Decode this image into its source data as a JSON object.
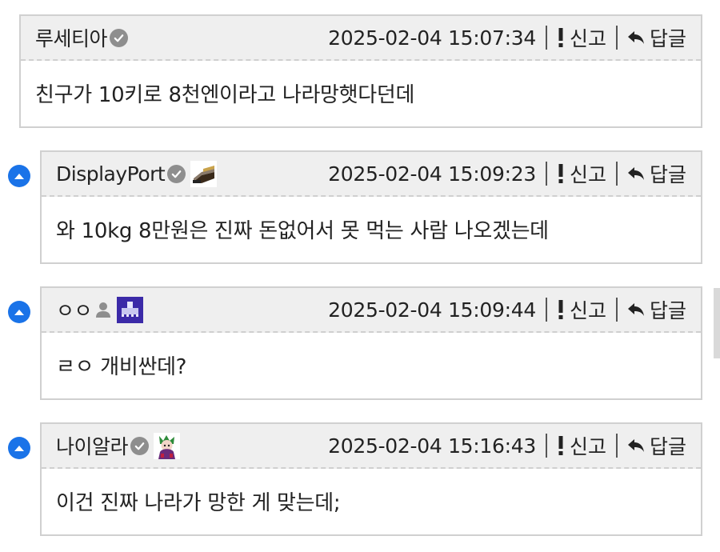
{
  "labels": {
    "report": "신고",
    "reply": "답글"
  },
  "colors": {
    "reply_dot": "#1a73e8",
    "header_bg": "#efefef",
    "border": "#d0d0d0"
  },
  "comments": [
    {
      "author": "루세티아",
      "verified": true,
      "avatar": null,
      "timestamp": "2025-02-04 15:07:34",
      "text": "친구가 10키로 8천엔이라고 나라망햇다던데",
      "is_reply": false
    },
    {
      "author": "DisplayPort",
      "verified": true,
      "avatar": "displayport-connector-icon",
      "timestamp": "2025-02-04 15:09:23",
      "text": "와 10kg 8만원은 진짜 돈없어서 못 먹는 사람 나오겠는데",
      "is_reply": true
    },
    {
      "author": "ㅇㅇ",
      "verified": false,
      "avatar": "pixel-building-icon",
      "timestamp": "2025-02-04 15:09:44",
      "text": "ㄹㅇ 개비싼데?",
      "is_reply": true
    },
    {
      "author": "나이알라",
      "verified": true,
      "avatar": "anime-character-icon",
      "timestamp": "2025-02-04 15:16:43",
      "text": "이건 진짜 나라가 망한 게 맞는데;",
      "is_reply": true
    }
  ]
}
